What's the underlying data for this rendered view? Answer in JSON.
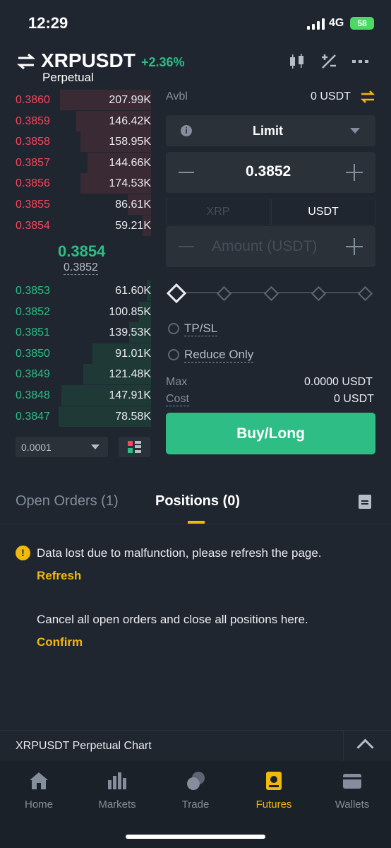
{
  "status_bar": {
    "time": "12:29",
    "network": "4G",
    "battery": "58"
  },
  "header": {
    "pair": "XRPUSDT",
    "change": "+2.36%",
    "subtitle": "Perpetual"
  },
  "order_book": {
    "asks": [
      {
        "price": "0.3860",
        "qty": "207.99K",
        "depth": 0.67
      },
      {
        "price": "0.3859",
        "qty": "146.42K",
        "depth": 0.55
      },
      {
        "price": "0.3858",
        "qty": "158.95K",
        "depth": 0.52
      },
      {
        "price": "0.3857",
        "qty": "144.66K",
        "depth": 0.47
      },
      {
        "price": "0.3856",
        "qty": "174.53K",
        "depth": 0.52
      },
      {
        "price": "0.3855",
        "qty": "86.61K",
        "depth": 0.17
      },
      {
        "price": "0.3854",
        "qty": "59.21K",
        "depth": 0.06
      }
    ],
    "last_price": "0.3854",
    "mark_price": "0.3852",
    "bids": [
      {
        "price": "0.3853",
        "qty": "61.60K",
        "depth": 0.03
      },
      {
        "price": "0.3852",
        "qty": "100.85K",
        "depth": 0.09
      },
      {
        "price": "0.3851",
        "qty": "139.53K",
        "depth": 0.16
      },
      {
        "price": "0.3850",
        "qty": "91.01K",
        "depth": 0.43
      },
      {
        "price": "0.3849",
        "qty": "121.48K",
        "depth": 0.5
      },
      {
        "price": "0.3848",
        "qty": "147.91K",
        "depth": 0.66
      },
      {
        "price": "0.3847",
        "qty": "78.58K",
        "depth": 0.68
      }
    ],
    "precision": "0.0001"
  },
  "form": {
    "avbl_label": "Avbl",
    "avbl_value": "0 USDT",
    "order_type": "Limit",
    "price": "0.3852",
    "unit_tabs": [
      "XRP",
      "USDT"
    ],
    "amount_placeholder": "Amount (USDT)",
    "slider_value": 0,
    "tpsl_label": "TP/SL",
    "reduce_only_label": "Reduce Only",
    "max_label": "Max",
    "max_value": "0.0000 USDT",
    "cost_label": "Cost",
    "cost_value": "0 USDT",
    "buy_label": "Buy/Long"
  },
  "tabs": {
    "open_orders": "Open Orders (1)",
    "positions": "Positions (0)"
  },
  "notice": {
    "error_text": "Data lost due to malfunction, please refresh the page.",
    "refresh_label": "Refresh",
    "cancel_text": "Cancel all open orders and close all positions here.",
    "confirm_label": "Confirm"
  },
  "chart_bar": {
    "label": "XRPUSDT Perpetual  Chart"
  },
  "bottom_nav": [
    "Home",
    "Markets",
    "Trade",
    "Futures",
    "Wallets"
  ],
  "colors": {
    "bg": "#1f2630",
    "green": "#2ebd85",
    "red": "#f6465d",
    "accent": "#f0b90b"
  }
}
